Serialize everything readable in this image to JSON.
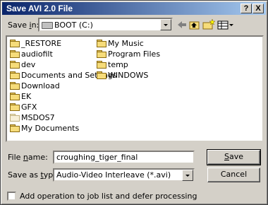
{
  "window": {
    "title": "Save AVI 2.0 File"
  },
  "titlebar_buttons": {
    "help": "?",
    "close": "X"
  },
  "save_in": {
    "label_prefix": "Save ",
    "label_key": "i",
    "label_suffix": "n:",
    "value": "BOOT (C:)"
  },
  "toolbar": {
    "icons": [
      "back-icon",
      "up-folder-icon",
      "new-folder-icon",
      "view-menu-icon"
    ]
  },
  "files": {
    "col1": [
      "_RESTORE",
      "audiofilt",
      "dev",
      "Documents and Settings",
      "Download",
      "EK",
      "GFX",
      "MSDOS7",
      "My Documents"
    ],
    "col2": [
      "My Music",
      "Program Files",
      "temp",
      "WINDOWS"
    ]
  },
  "file_name": {
    "label_prefix": "File ",
    "label_key": "n",
    "label_suffix": "ame:",
    "value": "croughing_tiger_final"
  },
  "save_as_type": {
    "label_prefix": "Save as ",
    "label_key": "t",
    "label_suffix": "ype:",
    "value": "Audio-Video Interleave (*.avi)"
  },
  "buttons": {
    "save_key": "S",
    "save_rest": "ave",
    "cancel": "Cancel"
  },
  "checkbox": {
    "label": "Add operation to job list and defer processing",
    "checked": false
  }
}
